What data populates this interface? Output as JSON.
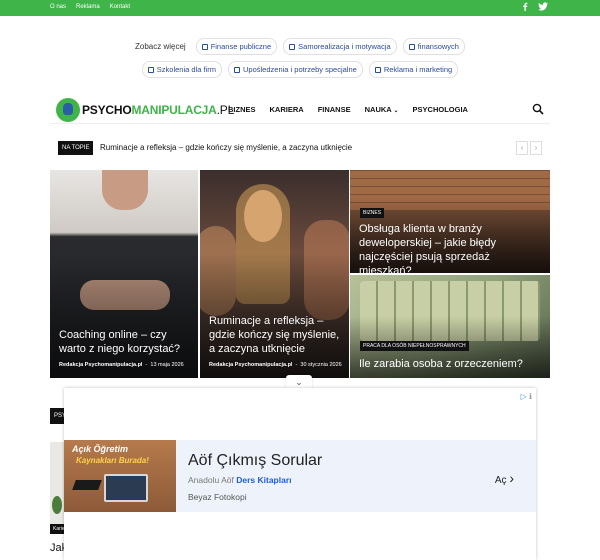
{
  "topbar": {
    "links": [
      "O nas",
      "Reklama",
      "Kontakt"
    ],
    "social": [
      "facebook-icon",
      "twitter-icon"
    ],
    "color": "#3fb449"
  },
  "see_also": {
    "label": "Zobacz więcej",
    "row1": [
      "Finanse publiczne",
      "Samorealizacja i motywacja",
      "finansowych"
    ],
    "row2": [
      "Szkolenia dla firm",
      "Upośledzenia i potrzeby specjalne",
      "Reklama i marketing"
    ]
  },
  "header": {
    "logo_dark": "PSYCHO",
    "logo_green": "MANIPULACJA",
    "logo_suffix": ".PL",
    "menu": [
      "BIZNES",
      "KARIERA",
      "FINANSE",
      "NAUKA",
      "PSYCHOLOGIA"
    ]
  },
  "ticker": {
    "tag": "NA TOPIE",
    "title": "Ruminacje a refleksja – gdzie kończy się myślenie, a zaczyna utknięcie"
  },
  "featured": [
    {
      "title": "Coaching online – czy warto z niego korzystać?",
      "author": "Redakcja Psychomanipulacja.pl",
      "date": "13 maja 2026"
    },
    {
      "title": "Ruminacje a refleksja – gdzie kończy się myślenie, a zaczyna utknięcie",
      "author": "Redakcja Psychomanipulacja.pl",
      "date": "30 stycznia 2026"
    },
    {
      "badge": "BIZNES",
      "title": "Obsługa klienta w branży deweloperskiej – jakie błędy najczęściej psują sprzedaż mieszkań?"
    },
    {
      "badge": "PRACA DLA OSÓB NIEPEŁNOSPRAWNYCH",
      "title": "Ile zarabia osoba z orzeczeniem?"
    }
  ],
  "partial_left": {
    "section": "PSY",
    "badge": "Kariera",
    "title": "Jak"
  },
  "ad": {
    "thumb_line1": "Açık Öğretim",
    "thumb_line2": "Kaynakları Burada!",
    "headline": "Aöf Çıkmış Sorular",
    "sub_prefix": "Anadolu Aöf",
    "sub_link": "Ders Kitapları",
    "sub2": "Beyaz Fotokopi",
    "cta": "Aç"
  }
}
